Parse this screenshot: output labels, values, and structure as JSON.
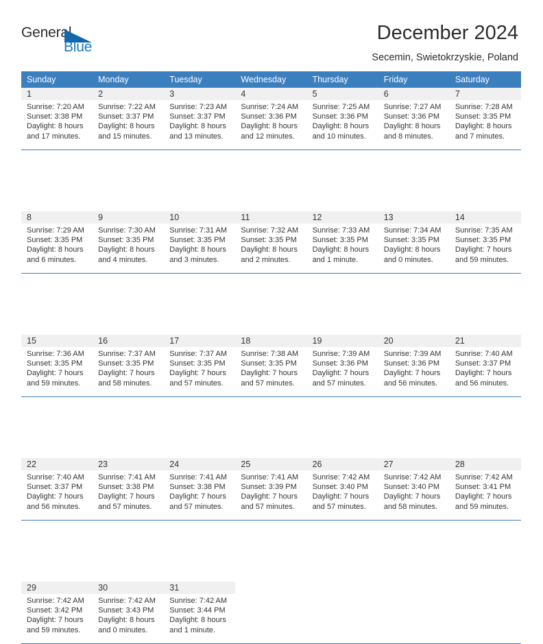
{
  "logo": {
    "word1": "General",
    "word2": "Blue",
    "triangle_color": "#1267ad",
    "blue_text_color": "#1878c8"
  },
  "header": {
    "title": "December 2024",
    "subtitle": "Secemin, Swietokrzyskie, Poland",
    "accent_color": "#3c7fbf",
    "daynum_band_color": "#f0f0f0"
  },
  "weekdays": [
    "Sunday",
    "Monday",
    "Tuesday",
    "Wednesday",
    "Thursday",
    "Friday",
    "Saturday"
  ],
  "calendar": {
    "month": "December",
    "year": 2024,
    "weeks": [
      [
        {
          "day": "1",
          "sunrise": "Sunrise: 7:20 AM",
          "sunset": "Sunset: 3:38 PM",
          "daylight1": "Daylight: 8 hours",
          "daylight2": "and 17 minutes."
        },
        {
          "day": "2",
          "sunrise": "Sunrise: 7:22 AM",
          "sunset": "Sunset: 3:37 PM",
          "daylight1": "Daylight: 8 hours",
          "daylight2": "and 15 minutes."
        },
        {
          "day": "3",
          "sunrise": "Sunrise: 7:23 AM",
          "sunset": "Sunset: 3:37 PM",
          "daylight1": "Daylight: 8 hours",
          "daylight2": "and 13 minutes."
        },
        {
          "day": "4",
          "sunrise": "Sunrise: 7:24 AM",
          "sunset": "Sunset: 3:36 PM",
          "daylight1": "Daylight: 8 hours",
          "daylight2": "and 12 minutes."
        },
        {
          "day": "5",
          "sunrise": "Sunrise: 7:25 AM",
          "sunset": "Sunset: 3:36 PM",
          "daylight1": "Daylight: 8 hours",
          "daylight2": "and 10 minutes."
        },
        {
          "day": "6",
          "sunrise": "Sunrise: 7:27 AM",
          "sunset": "Sunset: 3:36 PM",
          "daylight1": "Daylight: 8 hours",
          "daylight2": "and 8 minutes."
        },
        {
          "day": "7",
          "sunrise": "Sunrise: 7:28 AM",
          "sunset": "Sunset: 3:35 PM",
          "daylight1": "Daylight: 8 hours",
          "daylight2": "and 7 minutes."
        }
      ],
      [
        {
          "day": "8",
          "sunrise": "Sunrise: 7:29 AM",
          "sunset": "Sunset: 3:35 PM",
          "daylight1": "Daylight: 8 hours",
          "daylight2": "and 6 minutes."
        },
        {
          "day": "9",
          "sunrise": "Sunrise: 7:30 AM",
          "sunset": "Sunset: 3:35 PM",
          "daylight1": "Daylight: 8 hours",
          "daylight2": "and 4 minutes."
        },
        {
          "day": "10",
          "sunrise": "Sunrise: 7:31 AM",
          "sunset": "Sunset: 3:35 PM",
          "daylight1": "Daylight: 8 hours",
          "daylight2": "and 3 minutes."
        },
        {
          "day": "11",
          "sunrise": "Sunrise: 7:32 AM",
          "sunset": "Sunset: 3:35 PM",
          "daylight1": "Daylight: 8 hours",
          "daylight2": "and 2 minutes."
        },
        {
          "day": "12",
          "sunrise": "Sunrise: 7:33 AM",
          "sunset": "Sunset: 3:35 PM",
          "daylight1": "Daylight: 8 hours",
          "daylight2": "and 1 minute."
        },
        {
          "day": "13",
          "sunrise": "Sunrise: 7:34 AM",
          "sunset": "Sunset: 3:35 PM",
          "daylight1": "Daylight: 8 hours",
          "daylight2": "and 0 minutes."
        },
        {
          "day": "14",
          "sunrise": "Sunrise: 7:35 AM",
          "sunset": "Sunset: 3:35 PM",
          "daylight1": "Daylight: 7 hours",
          "daylight2": "and 59 minutes."
        }
      ],
      [
        {
          "day": "15",
          "sunrise": "Sunrise: 7:36 AM",
          "sunset": "Sunset: 3:35 PM",
          "daylight1": "Daylight: 7 hours",
          "daylight2": "and 59 minutes."
        },
        {
          "day": "16",
          "sunrise": "Sunrise: 7:37 AM",
          "sunset": "Sunset: 3:35 PM",
          "daylight1": "Daylight: 7 hours",
          "daylight2": "and 58 minutes."
        },
        {
          "day": "17",
          "sunrise": "Sunrise: 7:37 AM",
          "sunset": "Sunset: 3:35 PM",
          "daylight1": "Daylight: 7 hours",
          "daylight2": "and 57 minutes."
        },
        {
          "day": "18",
          "sunrise": "Sunrise: 7:38 AM",
          "sunset": "Sunset: 3:35 PM",
          "daylight1": "Daylight: 7 hours",
          "daylight2": "and 57 minutes."
        },
        {
          "day": "19",
          "sunrise": "Sunrise: 7:39 AM",
          "sunset": "Sunset: 3:36 PM",
          "daylight1": "Daylight: 7 hours",
          "daylight2": "and 57 minutes."
        },
        {
          "day": "20",
          "sunrise": "Sunrise: 7:39 AM",
          "sunset": "Sunset: 3:36 PM",
          "daylight1": "Daylight: 7 hours",
          "daylight2": "and 56 minutes."
        },
        {
          "day": "21",
          "sunrise": "Sunrise: 7:40 AM",
          "sunset": "Sunset: 3:37 PM",
          "daylight1": "Daylight: 7 hours",
          "daylight2": "and 56 minutes."
        }
      ],
      [
        {
          "day": "22",
          "sunrise": "Sunrise: 7:40 AM",
          "sunset": "Sunset: 3:37 PM",
          "daylight1": "Daylight: 7 hours",
          "daylight2": "and 56 minutes."
        },
        {
          "day": "23",
          "sunrise": "Sunrise: 7:41 AM",
          "sunset": "Sunset: 3:38 PM",
          "daylight1": "Daylight: 7 hours",
          "daylight2": "and 57 minutes."
        },
        {
          "day": "24",
          "sunrise": "Sunrise: 7:41 AM",
          "sunset": "Sunset: 3:38 PM",
          "daylight1": "Daylight: 7 hours",
          "daylight2": "and 57 minutes."
        },
        {
          "day": "25",
          "sunrise": "Sunrise: 7:41 AM",
          "sunset": "Sunset: 3:39 PM",
          "daylight1": "Daylight: 7 hours",
          "daylight2": "and 57 minutes."
        },
        {
          "day": "26",
          "sunrise": "Sunrise: 7:42 AM",
          "sunset": "Sunset: 3:40 PM",
          "daylight1": "Daylight: 7 hours",
          "daylight2": "and 57 minutes."
        },
        {
          "day": "27",
          "sunrise": "Sunrise: 7:42 AM",
          "sunset": "Sunset: 3:40 PM",
          "daylight1": "Daylight: 7 hours",
          "daylight2": "and 58 minutes."
        },
        {
          "day": "28",
          "sunrise": "Sunrise: 7:42 AM",
          "sunset": "Sunset: 3:41 PM",
          "daylight1": "Daylight: 7 hours",
          "daylight2": "and 59 minutes."
        }
      ],
      [
        {
          "day": "29",
          "sunrise": "Sunrise: 7:42 AM",
          "sunset": "Sunset: 3:42 PM",
          "daylight1": "Daylight: 7 hours",
          "daylight2": "and 59 minutes."
        },
        {
          "day": "30",
          "sunrise": "Sunrise: 7:42 AM",
          "sunset": "Sunset: 3:43 PM",
          "daylight1": "Daylight: 8 hours",
          "daylight2": "and 0 minutes."
        },
        {
          "day": "31",
          "sunrise": "Sunrise: 7:42 AM",
          "sunset": "Sunset: 3:44 PM",
          "daylight1": "Daylight: 8 hours",
          "daylight2": "and 1 minute."
        },
        {
          "day": "",
          "sunrise": "",
          "sunset": "",
          "daylight1": "",
          "daylight2": ""
        },
        {
          "day": "",
          "sunrise": "",
          "sunset": "",
          "daylight1": "",
          "daylight2": ""
        },
        {
          "day": "",
          "sunrise": "",
          "sunset": "",
          "daylight1": "",
          "daylight2": ""
        },
        {
          "day": "",
          "sunrise": "",
          "sunset": "",
          "daylight1": "",
          "daylight2": ""
        }
      ]
    ]
  }
}
